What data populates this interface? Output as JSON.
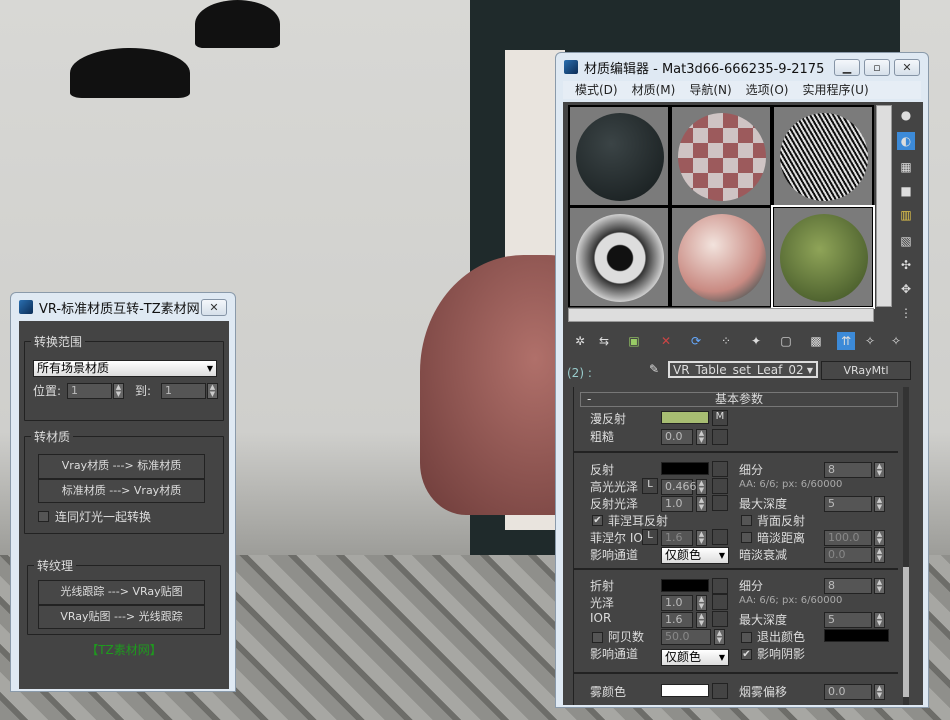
{
  "converter": {
    "title": "VR-标准材质互转-TZ素材网",
    "close": "✕",
    "range_group": "转换范围",
    "range_select": "所有场景材质",
    "position_label": "位置:",
    "position_value": "1",
    "to_label": "到:",
    "to_value": "1",
    "material_group": "转材质",
    "btn_vray_to_std": "Vray材质  ---> 标准材质",
    "btn_std_to_vray": "标准材质  ---> Vray材质",
    "with_lights": "连同灯光一起转换",
    "texture_group": "转纹理",
    "btn_rt_to_vray": "光线跟踪  ---> VRay贴图",
    "btn_vray_to_rt": "VRay贴图  ---> 光线跟踪",
    "footer": "【TZ素材网】",
    "footer_color": "#1e9a1e"
  },
  "editor": {
    "title": "材质编辑器 - Mat3d66-666235-9-2175",
    "menu": [
      "模式(D)",
      "材质(M)",
      "导航(N)",
      "选项(O)",
      "实用程序(U)"
    ],
    "slot_label": "(2) :",
    "material_name": "VR_Table_set_Leaf_02",
    "material_type": "VRayMtl",
    "rollout_title": "基本参数",
    "rollout_toggle": "-",
    "diffuse": {
      "label": "漫反射",
      "color": "#a7bd72",
      "map": "M"
    },
    "roughness": {
      "label": "粗糙",
      "value": "0.0"
    },
    "reflection": {
      "label": "反射",
      "subdiv_label": "细分",
      "subdiv": "8",
      "hilight_label": "高光光泽",
      "hilight": "0.466",
      "lock": "L",
      "aa_info": "AA: 6/6; px: 6/60000",
      "gloss_label": "反射光泽",
      "gloss": "1.0",
      "maxdepth_label": "最大深度",
      "maxdepth": "5",
      "fresnel_label": "菲涅耳反射",
      "fresnel_checked": true,
      "backside_label": "背面反射",
      "fresnel_ior_label": "菲涅尔 IOR",
      "fresnel_ior": "1.6",
      "dim_label": "暗淡距离",
      "dim": "100.0",
      "affect_label": "影响通道",
      "affect": "仅颜色",
      "dimfall_label": "暗淡衰减",
      "dimfall": "0.0"
    },
    "refraction": {
      "label": "折射",
      "subdiv_label": "细分",
      "subdiv": "8",
      "gloss_label": "光泽",
      "gloss": "1.0",
      "aa_info": "AA: 6/6; px: 6/60000",
      "ior_label": "IOR",
      "ior": "1.6",
      "maxdepth_label": "最大深度",
      "maxdepth": "5",
      "abbe_label": "阿贝数",
      "abbe": "50.0",
      "exit_label": "退出颜色",
      "affect_label": "影响通道",
      "affect": "仅颜色",
      "shadows_label": "影响阴影",
      "shadows_checked": true
    },
    "fog": {
      "label": "雾颜色",
      "bias_label": "烟雾偏移",
      "bias": "0.0"
    }
  }
}
